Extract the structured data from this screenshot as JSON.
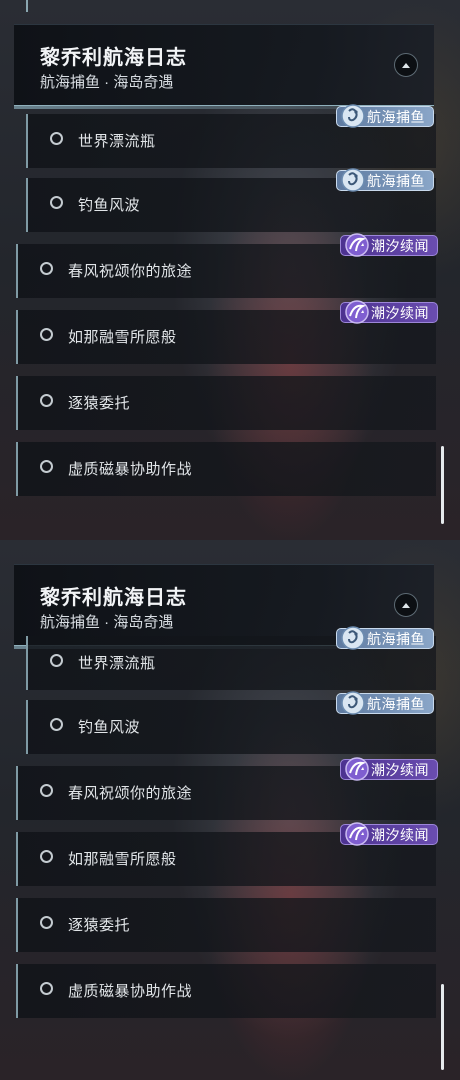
{
  "quest_log": {
    "title": "黎乔利航海日志",
    "subtitle": "航海捕鱼 · 海岛奇遇",
    "items": [
      {
        "label": "世界漂流瓶",
        "tag": "航海捕鱼"
      },
      {
        "label": "钓鱼风波",
        "tag": "航海捕鱼"
      },
      {
        "label": "春风祝颂你的旅途",
        "tag": "潮汐续闻"
      },
      {
        "label": "如那融雪所愿般",
        "tag": "潮汐续闻"
      },
      {
        "label": "逐猿委托",
        "tag": ""
      },
      {
        "label": "虚质磁暴协助作战",
        "tag": ""
      }
    ]
  },
  "icons": {
    "collapse": "chevron-up-icon",
    "fishing_tag": "fishing-hook-icon",
    "tide_tag": "tide-wave-icon",
    "radio": "radio-circle-icon"
  },
  "colors": {
    "fishing_tag": "#7a96bc",
    "tide_tag": "#5a3fa0",
    "divider": "#8fb0bc"
  }
}
